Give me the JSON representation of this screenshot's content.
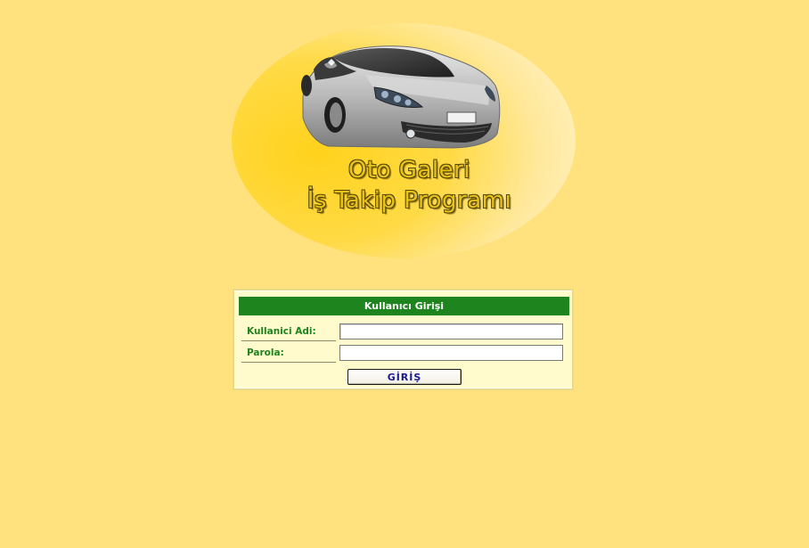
{
  "logo": {
    "line1": "Oto Galeri",
    "line2": "İş Takip Programı"
  },
  "login": {
    "title": "Kullanıcı Girişi",
    "username_label": "Kullanici Adi:",
    "username_value": "",
    "password_label": "Parola:",
    "password_value": "",
    "submit_label": "GİRİŞ"
  },
  "colors": {
    "page_background": "#FFE17E",
    "header_green": "#1E841E",
    "label_green": "#1E841E",
    "button_text": "#1A1A8E",
    "panel_background": "#FFFBCC"
  },
  "icons": {
    "logo_image": "car-logo-icon"
  }
}
